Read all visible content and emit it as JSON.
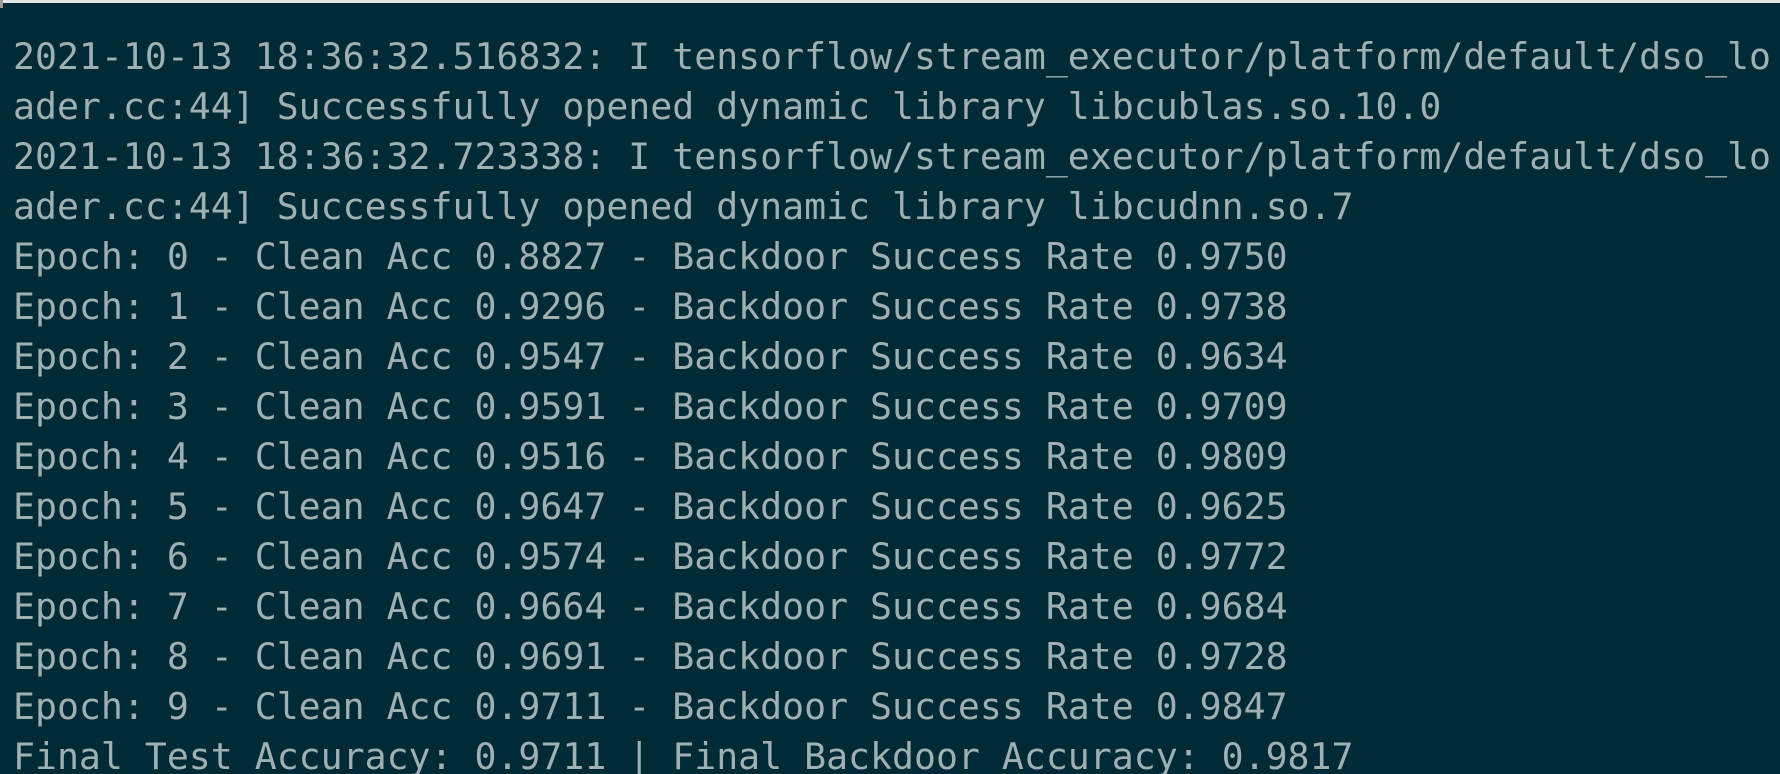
{
  "terminal": {
    "lines": [
      "2021-10-13 18:36:32.516832: I tensorflow/stream_executor/platform/default/dso_lo",
      "ader.cc:44] Successfully opened dynamic library libcublas.so.10.0",
      "2021-10-13 18:36:32.723338: I tensorflow/stream_executor/platform/default/dso_lo",
      "ader.cc:44] Successfully opened dynamic library libcudnn.so.7",
      "Epoch: 0 - Clean Acc 0.8827 - Backdoor Success Rate 0.9750",
      "Epoch: 1 - Clean Acc 0.9296 - Backdoor Success Rate 0.9738",
      "Epoch: 2 - Clean Acc 0.9547 - Backdoor Success Rate 0.9634",
      "Epoch: 3 - Clean Acc 0.9591 - Backdoor Success Rate 0.9709",
      "Epoch: 4 - Clean Acc 0.9516 - Backdoor Success Rate 0.9809",
      "Epoch: 5 - Clean Acc 0.9647 - Backdoor Success Rate 0.9625",
      "Epoch: 6 - Clean Acc 0.9574 - Backdoor Success Rate 0.9772",
      "Epoch: 7 - Clean Acc 0.9664 - Backdoor Success Rate 0.9684",
      "Epoch: 8 - Clean Acc 0.9691 - Backdoor Success Rate 0.9728",
      "Epoch: 9 - Clean Acc 0.9711 - Backdoor Success Rate 0.9847",
      "Final Test Accuracy: 0.9711 | Final Backdoor Accuracy: 0.9817"
    ]
  },
  "colors": {
    "background": "#002b36",
    "text": "#9fb0b3"
  }
}
